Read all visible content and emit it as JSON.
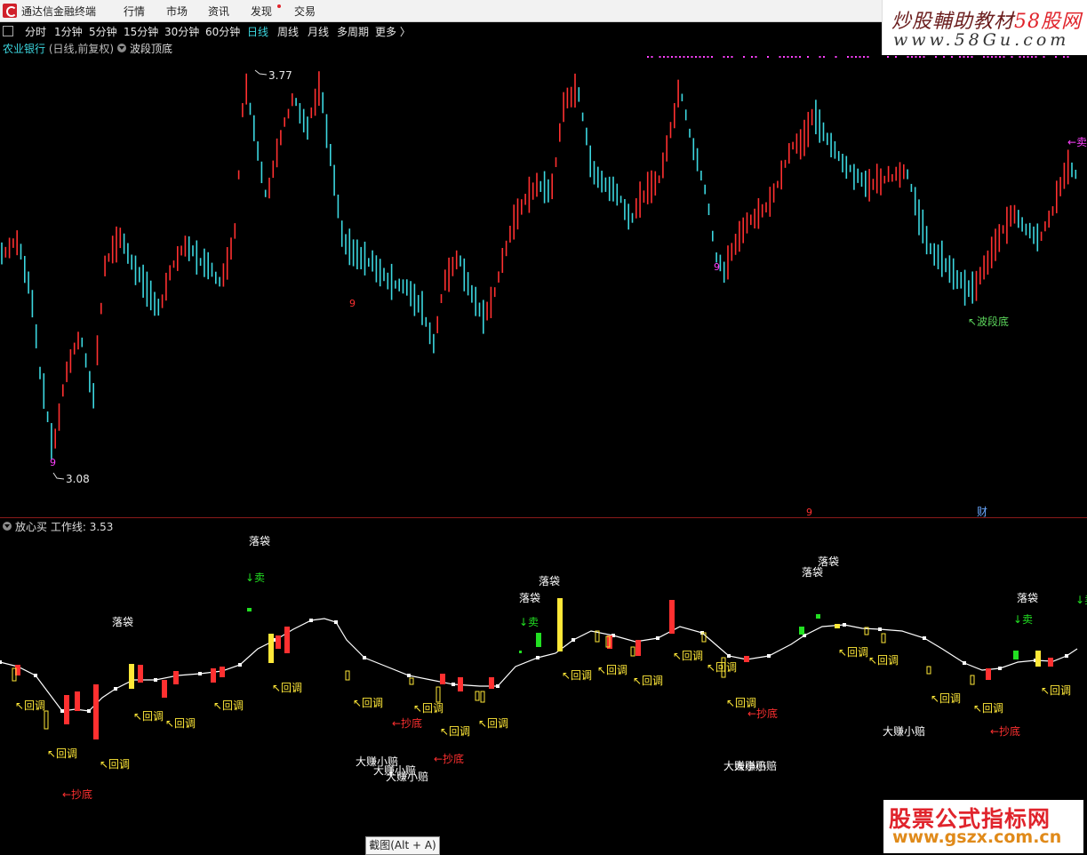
{
  "app": {
    "title": "通达信金融终端"
  },
  "menu": [
    {
      "label": "行情"
    },
    {
      "label": "市场"
    },
    {
      "label": "资讯"
    },
    {
      "label": "发现"
    },
    {
      "label": "交易"
    }
  ],
  "brand_top": {
    "line1_a": "炒股輔助教材",
    "line1_b": "58股网",
    "line2": "www.58Gu.com"
  },
  "periods": [
    "分时",
    "1分钟",
    "5分钟",
    "15分钟",
    "30分钟",
    "60分钟",
    "日线",
    "周线",
    "月线",
    "多周期",
    "更多 〉"
  ],
  "active_period": "日线",
  "stock": {
    "name": "农业银行",
    "mode": "(日线,前复权)",
    "indicator": "波段顶底"
  },
  "price": {
    "high_label": "3.77",
    "low_label": "3.08",
    "ymax": 3.77,
    "ymin": 3.08
  },
  "main_markers": {
    "nine_a": "9",
    "nine_b": "9",
    "nine_c": "9",
    "nine_d": "9",
    "sell_tag": "←卖",
    "bottom_tag": "↖波段底",
    "finance": "财"
  },
  "sub_indicator": {
    "name": "放心买",
    "work_line_label": "工作线: 3.53"
  },
  "sub_labels": {
    "luodai": "落袋",
    "sell": "↓卖",
    "huitiao": "↖回调",
    "chaodi": "←抄底",
    "dazhuan": "大赚小赔"
  },
  "colors": {
    "up": "#ff3030",
    "down": "#3cd7e0",
    "yellow": "#ffe838",
    "green": "#22e022",
    "magenta": "#ff40ff",
    "white": "#ffffff"
  },
  "brand_bottom": {
    "line1": "股票公式指标网",
    "line2": "www.gszx.com.cn"
  },
  "tooltip": "截图(Alt + A)"
}
